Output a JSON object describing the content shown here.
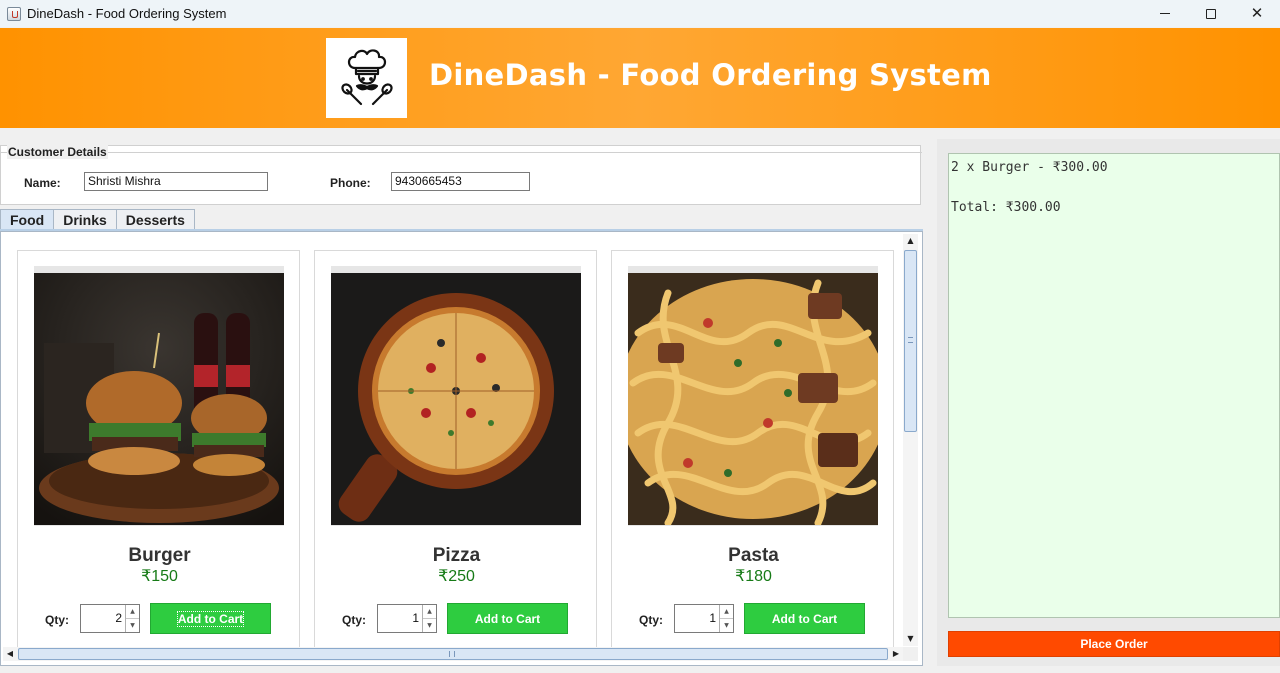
{
  "window": {
    "title": "DineDash - Food Ordering System",
    "controls": {
      "minimize": "minimize-icon",
      "maximize": "maximize-icon",
      "close": "close-icon"
    }
  },
  "header": {
    "title": "DineDash - Food Ordering System",
    "logo_icon": "chef-logo-icon",
    "background": "#ff9200"
  },
  "customer": {
    "legend": "Customer Details",
    "name_label": "Name:",
    "name_value": "Shristi Mishra",
    "phone_label": "Phone:",
    "phone_value": "9430665453"
  },
  "tabs": [
    {
      "label": "Food",
      "active": true
    },
    {
      "label": "Drinks",
      "active": false
    },
    {
      "label": "Desserts",
      "active": false
    }
  ],
  "products": [
    {
      "name": "Burger",
      "price": "₹150",
      "qty_label": "Qty:",
      "qty": "2",
      "button": "Add to Cart"
    },
    {
      "name": "Pizza",
      "price": "₹250",
      "qty_label": "Qty:",
      "qty": "1",
      "button": "Add to Cart"
    },
    {
      "name": "Pasta",
      "price": "₹180",
      "qty_label": "Qty:",
      "qty": "1",
      "button": "Add to Cart"
    }
  ],
  "order": {
    "summary_text": "2 x Burger - ₹300.00\n\nTotal: ₹300.00",
    "place_order_label": "Place Order",
    "place_order_color": "#ff4a00"
  },
  "colors": {
    "add_to_cart": "#2ecc40",
    "price": "#167a16",
    "summary_bg": "#eaffea"
  }
}
